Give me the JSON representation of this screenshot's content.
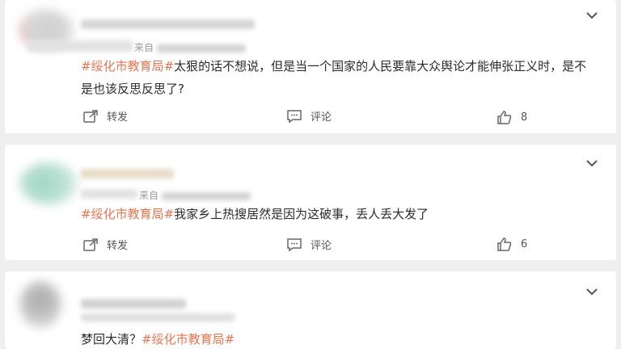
{
  "comments": [
    {
      "source_prefix": "来自",
      "text_tag": "#绥化市教育局#",
      "text_body": "太狠的话不想说，但是当一个国家的人民要靠大众舆论才能伸张正义时，是不是也该反思反思了?",
      "repost_label": "转发",
      "comment_label": "评论",
      "like_count": "8"
    },
    {
      "source_prefix": "来自",
      "text_tag": "#绥化市教育局#",
      "text_body": "我家乡上热搜居然是因为这破事，丢人丢大发了",
      "repost_label": "转发",
      "comment_label": "评论",
      "like_count": "6"
    },
    {
      "text_body": "梦回大清？",
      "text_tag": "#绥化市教育局#"
    }
  ],
  "colors": {
    "tag": "#eb7350",
    "page_bg": "#efefef",
    "card_bg": "#ffffff"
  },
  "icons": {
    "repost": "repost-icon",
    "comment": "comment-icon",
    "like": "thumbs-up-icon",
    "menu": "chevron-down-icon"
  }
}
